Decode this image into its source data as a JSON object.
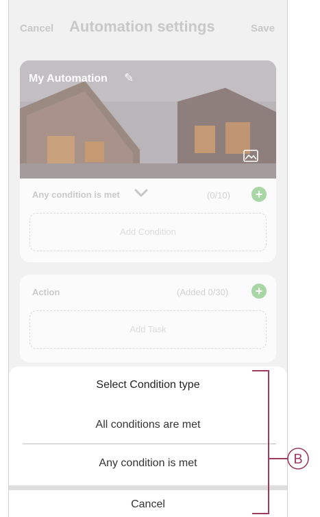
{
  "header": {
    "cancel": "Cancel",
    "title": "Automation settings",
    "save": "Save"
  },
  "automation": {
    "name": "My Automation",
    "edit_icon": "pencil-icon",
    "image_icon": "image-icon"
  },
  "conditions": {
    "header": "Any condition is met",
    "count": "(0/10)",
    "add_label": "Add Condition"
  },
  "action": {
    "header": "Action",
    "count": "(Added 0/30)",
    "add_label": "Add Task"
  },
  "sheet": {
    "title": "Select Condition type",
    "options": [
      "All conditions are met",
      "Any condition is met"
    ],
    "cancel": "Cancel"
  },
  "callout": {
    "label": "B",
    "color": "#a03a5c"
  },
  "colors": {
    "accent_green": "#a8d7a5",
    "muted_text": "#c8c8c8",
    "callout": "#a03a5c"
  }
}
